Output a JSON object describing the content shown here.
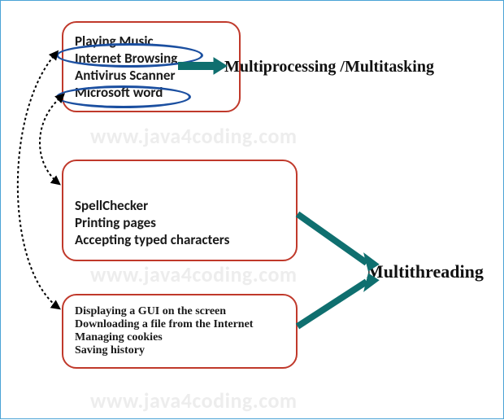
{
  "watermark": "www.java4coding.com",
  "box1": {
    "items": [
      "Playing Music",
      "Internet Browsing",
      "Antivirus Scanner",
      "Microsoft word"
    ]
  },
  "box2": {
    "items": [
      "SpellChecker",
      "Printing pages",
      "Accepting typed characters"
    ]
  },
  "box3": {
    "items": [
      "Displaying a GUI on the screen",
      "Downloading a file from the Internet",
      "Managing cookies",
      "Saving history"
    ]
  },
  "labels": {
    "multiprocessing": "Multiprocessing /Multitasking",
    "multithreading": "Multithreading"
  }
}
